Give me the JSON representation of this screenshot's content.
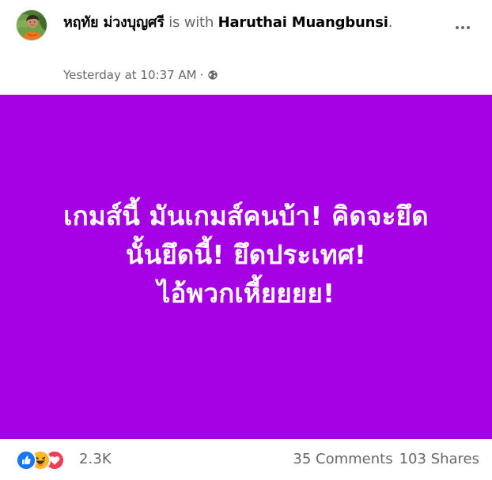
{
  "colors": {
    "post_background": "#a600e5",
    "post_text": "#ffffff",
    "muted_text": "#65676b",
    "like_blue": "#1877f2",
    "haha_yellow": "#f7b928",
    "love_red": "#f33e58"
  },
  "post": {
    "author_name": "หฤทัย ม่วงบุญศรี",
    "with_text": "is with",
    "tagged_person": "Haruthai Muangbunsi",
    "tagged_suffix": ".",
    "timestamp": "Yesterday at 10:37 AM",
    "separator": "·",
    "privacy_icon": "globe-icon",
    "more_icon": "ellipsis-icon",
    "text_lines": [
      "เกมส์นี้ มันเกมส์คนบ้า! คิดจะยึด",
      "นั้นยึดนี้! ยึดประเทศ!",
      "ไอ้พวกเหี้ยยยย!"
    ]
  },
  "engagement": {
    "reaction_icons": [
      "like-icon",
      "haha-icon",
      "love-icon"
    ],
    "reaction_count": "2.3K",
    "comments": "35 Comments",
    "shares": "103 Shares"
  }
}
